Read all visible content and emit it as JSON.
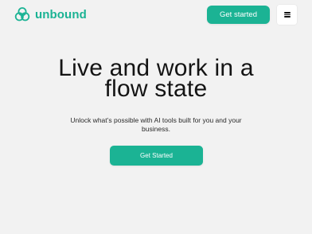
{
  "brand": {
    "name": "unbound",
    "logo_icon": "triple-circle-logo-icon",
    "accent_color": "#1bb394"
  },
  "header": {
    "cta_label": "Get started",
    "menu_icon": "hamburger-menu-icon"
  },
  "hero": {
    "title_line1": "Live and work in a",
    "title_line2": "flow state",
    "subtitle_line1": "Unlock what’s possible with AI tools built for you and your",
    "subtitle_line2": "business.",
    "cta_label": "Get Started"
  },
  "colors": {
    "background": "#f2f2f2",
    "accent": "#1bb394",
    "text": "#141414"
  }
}
